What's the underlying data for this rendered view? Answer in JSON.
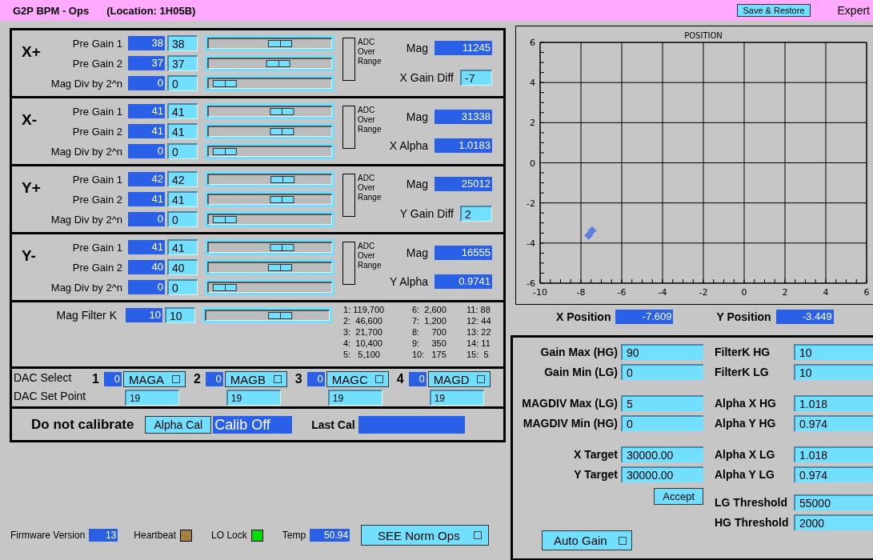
{
  "header": {
    "title": "G2P BPM - Ops",
    "location": "(Location: 1H05B)",
    "save_button": "Save & Restore",
    "expert": "Expert"
  },
  "channels": [
    {
      "name": "X+",
      "adc_label": "ADC Over Range",
      "rows": [
        {
          "label": "Pre Gain 1",
          "readback": "38",
          "setpoint": "38",
          "level": 0.6
        },
        {
          "label": "Pre Gain 2",
          "readback": "37",
          "setpoint": "37",
          "level": 0.58
        },
        {
          "label": "Mag Div by 2^n",
          "readback": "0",
          "setpoint": "0",
          "level": 0.04
        }
      ],
      "readouts": [
        {
          "label": "Mag",
          "value": "11245",
          "kind": "readback"
        },
        {
          "label": "X Gain Diff",
          "value": "-7",
          "kind": "input"
        }
      ]
    },
    {
      "name": "X-",
      "adc_label": "ADC Over Range",
      "rows": [
        {
          "label": "Pre Gain 1",
          "readback": "41",
          "setpoint": "41",
          "level": 0.62
        },
        {
          "label": "Pre Gain 2",
          "readback": "41",
          "setpoint": "41",
          "level": 0.62
        },
        {
          "label": "Mag Div by 2^n",
          "readback": "0",
          "setpoint": "0",
          "level": 0.04
        }
      ],
      "readouts": [
        {
          "label": "Mag",
          "value": "31338",
          "kind": "readback"
        },
        {
          "label": "X Alpha",
          "value": "1.0183",
          "kind": "readback"
        }
      ]
    },
    {
      "name": "Y+",
      "adc_label": "ADC Over Range",
      "rows": [
        {
          "label": "Pre Gain 1",
          "readback": "42",
          "setpoint": "42",
          "level": 0.63
        },
        {
          "label": "Pre Gain 2",
          "readback": "41",
          "setpoint": "41",
          "level": 0.62
        },
        {
          "label": "Mag Div by 2^n",
          "readback": "0",
          "setpoint": "0",
          "level": 0.04
        }
      ],
      "readouts": [
        {
          "label": "Mag",
          "value": "25012",
          "kind": "readback"
        },
        {
          "label": "Y Gain Diff",
          "value": "2",
          "kind": "input"
        }
      ]
    },
    {
      "name": "Y-",
      "adc_label": "ADC Over Range",
      "rows": [
        {
          "label": "Pre Gain 1",
          "readback": "41",
          "setpoint": "41",
          "level": 0.62
        },
        {
          "label": "Pre Gain 2",
          "readback": "40",
          "setpoint": "40",
          "level": 0.6
        },
        {
          "label": "Mag Div by 2^n",
          "readback": "0",
          "setpoint": "0",
          "level": 0.04
        }
      ],
      "readouts": [
        {
          "label": "Mag",
          "value": "16555",
          "kind": "readback"
        },
        {
          "label": "Y Alpha",
          "value": "0.9741",
          "kind": "readback"
        }
      ]
    }
  ],
  "mag_filter": {
    "label": "Mag Filter K",
    "readback": "10",
    "setpoint": "10",
    "level": 0.63,
    "table": [
      "1: 119,700",
      "2:  46,600",
      "3:  21,700",
      "4:  10,400",
      "5:   5,100",
      "6:  2,600",
      "7:  1,200",
      "8:     700",
      "9:     350",
      "10:   175",
      "11: 88",
      "12: 44",
      "13: 22",
      "14: 11",
      "15:  5"
    ]
  },
  "dac": {
    "select_label": "DAC Select",
    "setpoint_label": "DAC Set Point",
    "channels": [
      {
        "number": "1",
        "readback": "0",
        "menu": "MAGA",
        "setpoint": "19"
      },
      {
        "number": "2",
        "readback": "0",
        "menu": "MAGB",
        "setpoint": "19"
      },
      {
        "number": "3",
        "readback": "0",
        "menu": "MAGC",
        "setpoint": "19"
      },
      {
        "number": "4",
        "readback": "0",
        "menu": "MAGD",
        "setpoint": "19"
      }
    ]
  },
  "calibration": {
    "status": "Do not calibrate",
    "button": "Alpha Cal",
    "state": "Calib Off",
    "last_cal_label": "Last Cal"
  },
  "footer": {
    "firmware_label": "Firmware Version",
    "firmware": "13",
    "indicators": [
      {
        "label": "Heartbeat",
        "color": "#a47f3d"
      },
      {
        "label": "LO Lock",
        "color": "#00dd00"
      }
    ],
    "temp_label": "Temp",
    "temp": "50.94",
    "button": "SEE Norm Ops"
  },
  "chart": {
    "chart_data": {
      "type": "scatter",
      "title": "POSITION",
      "grid": true,
      "xlim": [
        -10,
        6
      ],
      "ylim": [
        -6,
        6
      ],
      "xticks": [
        -10,
        -8,
        -6,
        -4,
        -2,
        0,
        2,
        4,
        6
      ],
      "yticks": [
        -6,
        -4,
        -2,
        0,
        2,
        4,
        6
      ],
      "x": [
        -7.45,
        -7.62
      ],
      "series": [
        {
          "color": "#5b7ee0",
          "values": [
            -3.38,
            -3.62
          ]
        }
      ]
    },
    "x_label": "X Position",
    "x_value": "-7.609",
    "y_label": "Y Position",
    "y_value": "-3.449"
  },
  "auto_gain": {
    "left": [
      [
        {
          "label": "Gain Max (HG)",
          "value": "90"
        },
        {
          "label": "Gain Min (LG)",
          "value": "0"
        }
      ],
      [
        {
          "label": "MAGDIV Max (LG)",
          "value": "5"
        },
        {
          "label": "MAGDIV Min (HG)",
          "value": "0"
        }
      ],
      [
        {
          "label": "X Target",
          "value": "30000.00"
        },
        {
          "label": "Y Target",
          "value": "30000.00"
        }
      ]
    ],
    "accept": "Accept",
    "auto_gain_button": "Auto Gain",
    "right": [
      [
        {
          "label": "FilterK HG",
          "value": "10"
        },
        {
          "label": "FilterK LG",
          "value": "10"
        }
      ],
      [
        {
          "label": "Alpha X HG",
          "value": "1.018"
        },
        {
          "label": "Alpha Y HG",
          "value": "0.974"
        }
      ],
      [
        {
          "label": "Alpha X LG",
          "value": "1.018"
        },
        {
          "label": "Alpha Y LG",
          "value": "0.974"
        }
      ],
      [
        {
          "label": "LG Threshold",
          "value": "55000"
        },
        {
          "label": "HG Threshold",
          "value": "2000"
        }
      ]
    ]
  }
}
